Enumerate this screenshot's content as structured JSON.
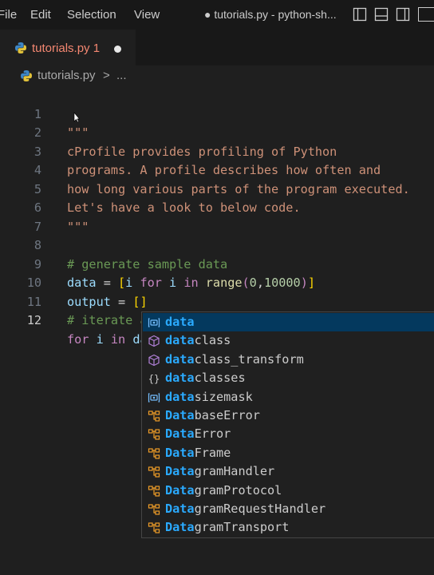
{
  "menu": [
    "File",
    "Edit",
    "Selection",
    "View"
  ],
  "window_title": "● tutorials.py - python-sh...",
  "tab": {
    "label": "tutorials.py 1",
    "dirty": true
  },
  "breadcrumb": {
    "file": "tutorials.py",
    "separator": ">",
    "more": "..."
  },
  "editor": {
    "line_numbers": [
      "1",
      "2",
      "3",
      "4",
      "5",
      "6",
      "7",
      "8",
      "9",
      "10",
      "11",
      "12"
    ],
    "active_line": "12",
    "lines": {
      "l1": "\"\"\"",
      "l2": "cProfile provides profiling of Python",
      "l3": "programs. A profile describes how often and",
      "l4": "how long various parts of the program executed.",
      "l5": "Let's have a look to below code.",
      "l6": "\"\"\"",
      "l7": "",
      "l8": "# generate sample data",
      "l9": {
        "var": "data",
        "eq": " = ",
        "lb": "[",
        "i1": "i",
        "for": " for ",
        "i2": "i",
        "in": " in ",
        "fn": "range",
        "lp": "(",
        "n1": "0",
        "comma": ",",
        "n2": "10000",
        "rp": ")",
        "rb": "]"
      },
      "l10": {
        "var": "output",
        "eq": " = ",
        "br": "[]"
      },
      "l11": "# iterate and append to list",
      "l12": {
        "for": "for",
        "i": " i ",
        "in": "in",
        "data": " data"
      }
    }
  },
  "suggestions": [
    {
      "match": "data",
      "rest": "",
      "kind": "variable",
      "selected": true
    },
    {
      "match": "data",
      "rest": "class",
      "kind": "module"
    },
    {
      "match": "data",
      "rest": "class_transform",
      "kind": "module"
    },
    {
      "match": "data",
      "rest": "classes",
      "kind": "namespace"
    },
    {
      "match": "data",
      "rest": "sizemask",
      "kind": "variable"
    },
    {
      "match": "Data",
      "rest": "baseError",
      "kind": "class"
    },
    {
      "match": "Data",
      "rest": "Error",
      "kind": "class"
    },
    {
      "match": "Data",
      "rest": "Frame",
      "kind": "class"
    },
    {
      "match": "Data",
      "rest": "gramHandler",
      "kind": "class"
    },
    {
      "match": "Data",
      "rest": "gramProtocol",
      "kind": "class"
    },
    {
      "match": "Data",
      "rest": "gramRequestHandler",
      "kind": "class"
    },
    {
      "match": "Data",
      "rest": "gramTransport",
      "kind": "class"
    }
  ],
  "colors": {
    "accent": "#2aaaff",
    "selection": "#04395e",
    "tab_error": "#f48771"
  },
  "icons": [
    "python-file-icon",
    "layout-sidebar-icon",
    "layout-panel-icon",
    "layout-split-icon"
  ]
}
